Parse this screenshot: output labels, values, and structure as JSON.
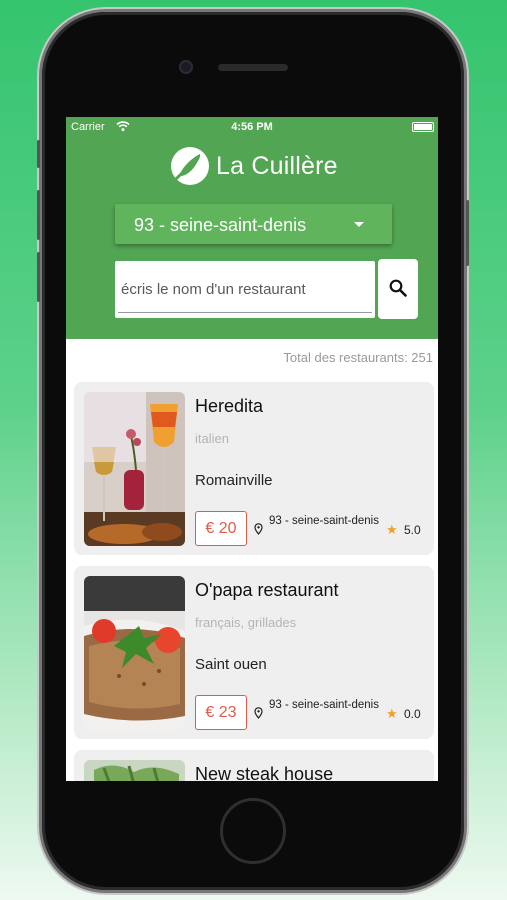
{
  "status_bar": {
    "carrier": "Carrier",
    "time": "4:56 PM"
  },
  "header": {
    "app_name": "La Cuillère",
    "department_select": "93 - seine-saint-denis",
    "search_placeholder": "écris le nom d'un restaurant",
    "bg_color": "#52a552"
  },
  "list": {
    "total_label": "Total des restaurants: 251",
    "restaurants": [
      {
        "name": "Heredita",
        "cuisine": "italien",
        "city": "Romainville",
        "price": "€ 20",
        "location": "93 - seine-saint-denis",
        "rating": "5.0"
      },
      {
        "name": "O'papa restaurant",
        "cuisine": "français, grillades",
        "city": "Saint ouen",
        "price": "€ 23",
        "location": "93 - seine-saint-denis",
        "rating": "0.0"
      },
      {
        "name": "New steak house",
        "cuisine": "",
        "city": "",
        "price": "",
        "location": "",
        "rating": ""
      }
    ]
  },
  "icons": {
    "logo": "spoon-logo-icon",
    "dropdown": "caret-down-icon",
    "search": "search-icon",
    "location": "map-pin-icon",
    "rating": "star-icon"
  },
  "colors": {
    "accent_green": "#52a552",
    "price_red": "#e05a4a",
    "star_orange": "#f0a020"
  }
}
